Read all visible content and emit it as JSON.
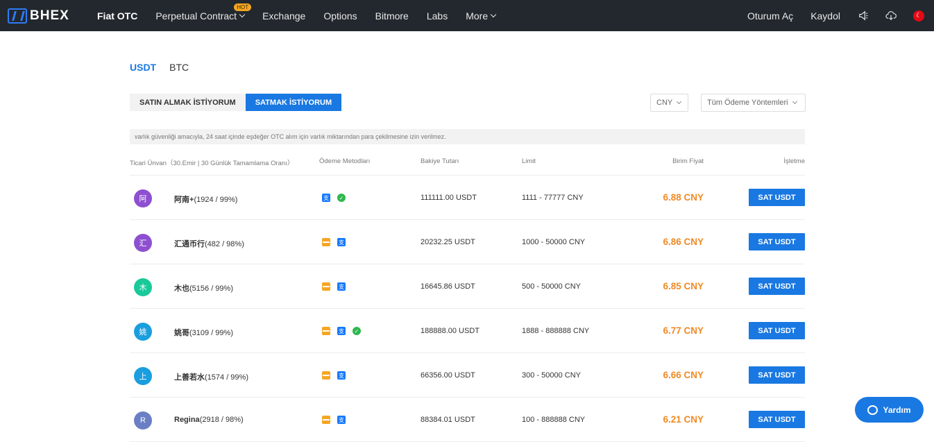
{
  "nav": {
    "logo": "BHEX",
    "items": [
      {
        "label": "Fiat OTC",
        "active": true,
        "dropdown": false
      },
      {
        "label": "Perpetual Contract",
        "active": false,
        "dropdown": true,
        "badge": "HOT"
      },
      {
        "label": "Exchange",
        "active": false,
        "dropdown": false
      },
      {
        "label": "Options",
        "active": false,
        "dropdown": false
      },
      {
        "label": "Bitmore",
        "active": false,
        "dropdown": false
      },
      {
        "label": "Labs",
        "active": false,
        "dropdown": false
      },
      {
        "label": "More",
        "active": false,
        "dropdown": true
      }
    ],
    "login": "Oturum Aç",
    "register": "Kaydol",
    "icons": [
      "announcement-icon",
      "download-icon",
      "language-flag-icon"
    ]
  },
  "coin_tabs": [
    {
      "label": "USDT",
      "active": true
    },
    {
      "label": "BTC",
      "active": false
    }
  ],
  "side_tabs": [
    {
      "label": "SATIN ALMAK İSTİYORUM",
      "active": false
    },
    {
      "label": "SATMAK İSTİYORUM",
      "active": true
    }
  ],
  "filters": {
    "currency": "CNY",
    "payment": "Tüm Ödeme Yöntemleri"
  },
  "notice": "varlık güvenliği amacıyla, 24 saat içinde eşdeğer OTC alım için varlık miktarından para çekilmesine izin verilmez.",
  "table": {
    "headers": {
      "merchant": "Ticari Ünvan（30.Emir | 30 Günlük Tamamlama Oranı）",
      "payment": "Ödeme Metodları",
      "balance": "Bakiye Tutarı",
      "limit": "Limit",
      "price": "Birim Fiyat",
      "action": "İşletme"
    },
    "rows": [
      {
        "avatar": "阿",
        "avatar_color": "#8e4fd1",
        "name": "阿南+",
        "stats": "(1924 / 99%)",
        "payments": [
          "alipay",
          "wechat"
        ],
        "balance": "111111.00 USDT",
        "limit": "1111 - 77777 CNY",
        "price": "6.88 CNY",
        "action": "SAT USDT"
      },
      {
        "avatar": "汇",
        "avatar_color": "#8e4fd1",
        "name": "汇通币行",
        "stats": "(482 / 98%)",
        "payments": [
          "bank",
          "alipay"
        ],
        "balance": "20232.25 USDT",
        "limit": "1000 - 50000 CNY",
        "price": "6.86 CNY",
        "action": "SAT USDT"
      },
      {
        "avatar": "木",
        "avatar_color": "#19c999",
        "name": "木也",
        "stats": "(5156 / 99%)",
        "payments": [
          "bank",
          "alipay"
        ],
        "balance": "16645.86 USDT",
        "limit": "500 - 50000 CNY",
        "price": "6.85 CNY",
        "action": "SAT USDT"
      },
      {
        "avatar": "姚",
        "avatar_color": "#1a9ede",
        "name": "姚哥",
        "stats": "(3109 / 99%)",
        "payments": [
          "bank",
          "alipay",
          "wechat"
        ],
        "balance": "188888.00 USDT",
        "limit": "1888 - 888888 CNY",
        "price": "6.77 CNY",
        "action": "SAT USDT"
      },
      {
        "avatar": "上",
        "avatar_color": "#1a9ede",
        "name": "上善若水",
        "stats": "(1574 / 99%)",
        "payments": [
          "bank",
          "alipay"
        ],
        "balance": "66356.00 USDT",
        "limit": "300 - 50000 CNY",
        "price": "6.66 CNY",
        "action": "SAT USDT"
      },
      {
        "avatar": "R",
        "avatar_color": "#6b7fc4",
        "name": "Regina",
        "stats": "(2918 / 98%)",
        "payments": [
          "bank",
          "alipay"
        ],
        "balance": "88384.01 USDT",
        "limit": "100 - 888888 CNY",
        "price": "6.21 CNY",
        "action": "SAT USDT"
      }
    ]
  },
  "help": "Yardım"
}
